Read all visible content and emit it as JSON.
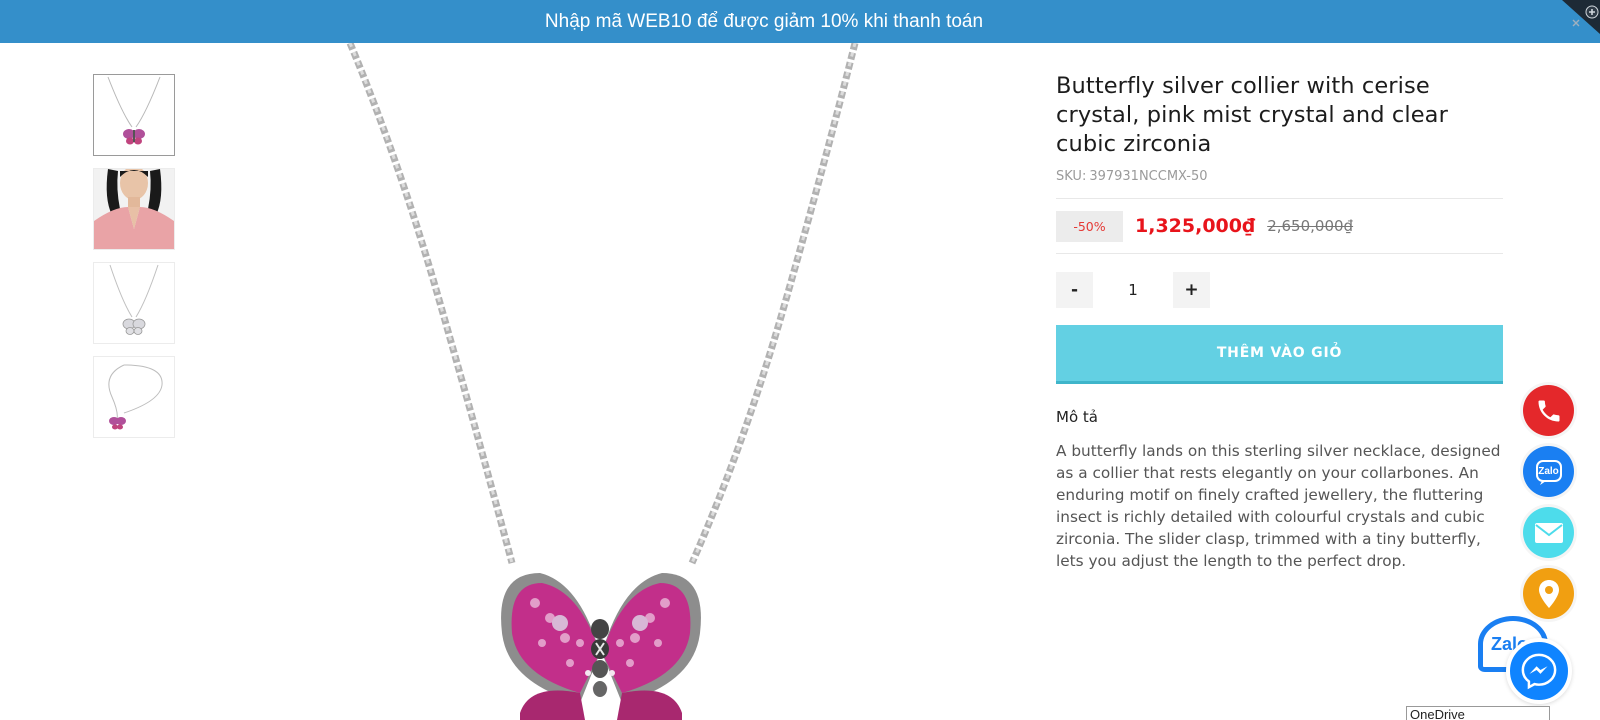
{
  "promo": {
    "text": "Nhập mã WEB10 để được giảm 10% khi thanh toán",
    "close_icon": "close-corner-icon",
    "color": "#348fca"
  },
  "gallery": {
    "thumbnails": [
      {
        "alt": "necklace-front",
        "active": true
      },
      {
        "alt": "model-wearing",
        "active": false
      },
      {
        "alt": "necklace-clear",
        "active": false
      },
      {
        "alt": "necklace-side",
        "active": false
      }
    ]
  },
  "product": {
    "title": "Butterfly silver collier with cerise crystal, pink mist crystal and clear cubic zirconia",
    "sku_label": "SKU:",
    "sku": "397931NCCMX-50",
    "discount": "-50%",
    "price": "1,325,000₫",
    "old_price": "2,650,000₫",
    "price_color": "#e8141b"
  },
  "quantity": {
    "minus": "-",
    "value": "1",
    "plus": "+"
  },
  "cart": {
    "add_label": "THÊM VÀO GIỎ",
    "color": "#63d0e3"
  },
  "description": {
    "heading": "Mô tả",
    "text": "A butterfly lands on this sterling silver necklace, designed as a collier that rests elegantly on your collarbones. An enduring motif on finely crafted jewellery, the fluttering insect is richly detailed with colourful crystals and cubic zirconia. The slider clasp, trimmed with a tiny butterfly, lets you adjust the length to the perfect drop."
  },
  "floating": {
    "phone_icon": "phone-icon",
    "zalo_label": "Zalo",
    "mail_icon": "mail-icon",
    "map_icon": "map-pin-icon",
    "zalo_chat_label": "Zalo",
    "messenger_icon": "messenger-icon"
  },
  "onedrive_label": "OneDrive"
}
